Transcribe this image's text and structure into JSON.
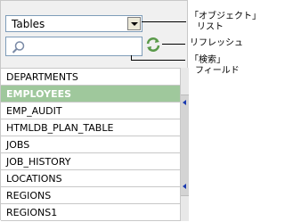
{
  "object_type_select": {
    "value": "Tables"
  },
  "search": {
    "placeholder": ""
  },
  "list": {
    "items": [
      "DEPARTMENTS",
      "EMPLOYEES",
      "EMP_AUDIT",
      "HTMLDB_PLAN_TABLE",
      "JOBS",
      "JOB_HISTORY",
      "LOCATIONS",
      "REGIONS",
      "REGIONS1"
    ],
    "selected_index": 1
  },
  "callouts": {
    "object_list_line1": "「オブジェクト」",
    "object_list_line2": "リスト",
    "refresh": "リフレッシュ",
    "search_field_line1": "「検索」",
    "search_field_line2": "フィールド"
  },
  "colors": {
    "selected_row_bg": "#9fc89c",
    "refresh_icon": "#5a9a4a"
  }
}
